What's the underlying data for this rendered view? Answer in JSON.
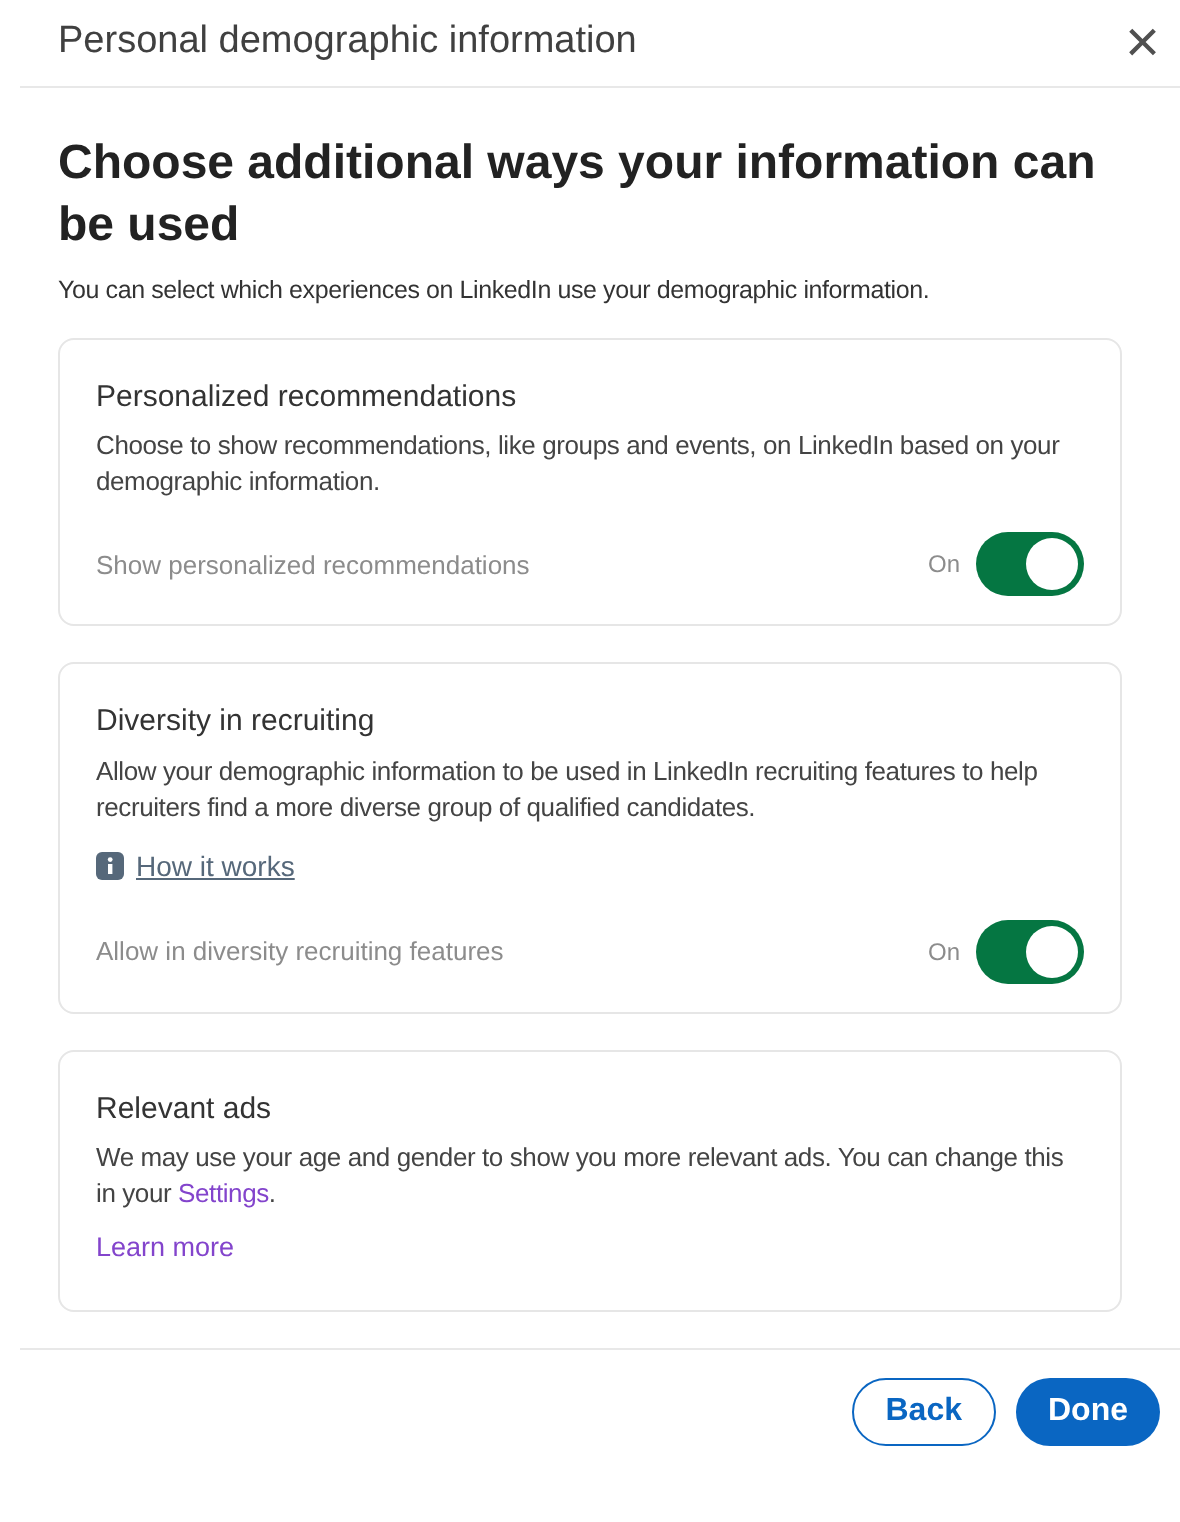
{
  "dialog": {
    "title": "Personal demographic information",
    "close": "×"
  },
  "heading": "Choose additional ways your information can be used",
  "intro": "You can select which experiences on LinkedIn use your demographic information.",
  "cards": [
    {
      "title": "Personalized recommendations",
      "description": "Choose to show recommendations, like groups and events, on LinkedIn based on your demographic information.",
      "setting": {
        "label": "Show personalized recommendations",
        "state_text": "On",
        "on": true
      }
    },
    {
      "title": "Diversity in recruiting",
      "description": "Allow your demographic information to be used in LinkedIn recruiting features to help recruiters find a more diverse group of qualified candidates.",
      "help_link": "How it works",
      "setting": {
        "label": "Allow in diversity recruiting features",
        "state_text": "On",
        "on": true
      }
    },
    {
      "title": "Relevant ads",
      "description": "We may use your age and gender to show you more relevant ads. You can change this in your ",
      "inline_link": "Settings",
      "description_end": ".",
      "learn_more": "Learn more"
    }
  ],
  "buttons": [
    {
      "label": "Back",
      "kind": "secondary"
    },
    {
      "label": "Done",
      "kind": "primary"
    }
  ]
}
